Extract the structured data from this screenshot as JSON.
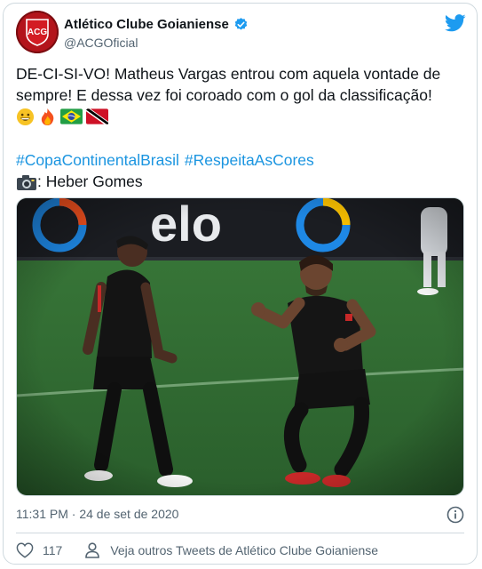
{
  "tweet": {
    "author_name": "Atlético Clube Goianiense",
    "author_handle": "@ACGOficial",
    "text_line1": "DE-CI-SI-VO! Matheus Vargas entrou com aquela vontade de",
    "text_line2": "sempre! E dessa vez foi coroado com o gol da classificação!",
    "emojis": [
      "grinning-face",
      "fire",
      "flag-brazil",
      "flag-trinidad-tobago"
    ],
    "hashtag1": "#CopaContinentalBrasil",
    "hashtag2": "#RespeitaAsCores",
    "credit_text": ": Heber Gomes",
    "timestamp": "11:31 PM · 24 de set de 2020",
    "like_count": "117",
    "more_tweets_label": "Veja outros Tweets de Atlético Clube Goianiense",
    "photo_board_text": "elo"
  },
  "colors": {
    "link": "#1b95e0",
    "verified": "#1d9bf0",
    "club_red": "#b3141b",
    "pitch": "#2f6a33"
  }
}
